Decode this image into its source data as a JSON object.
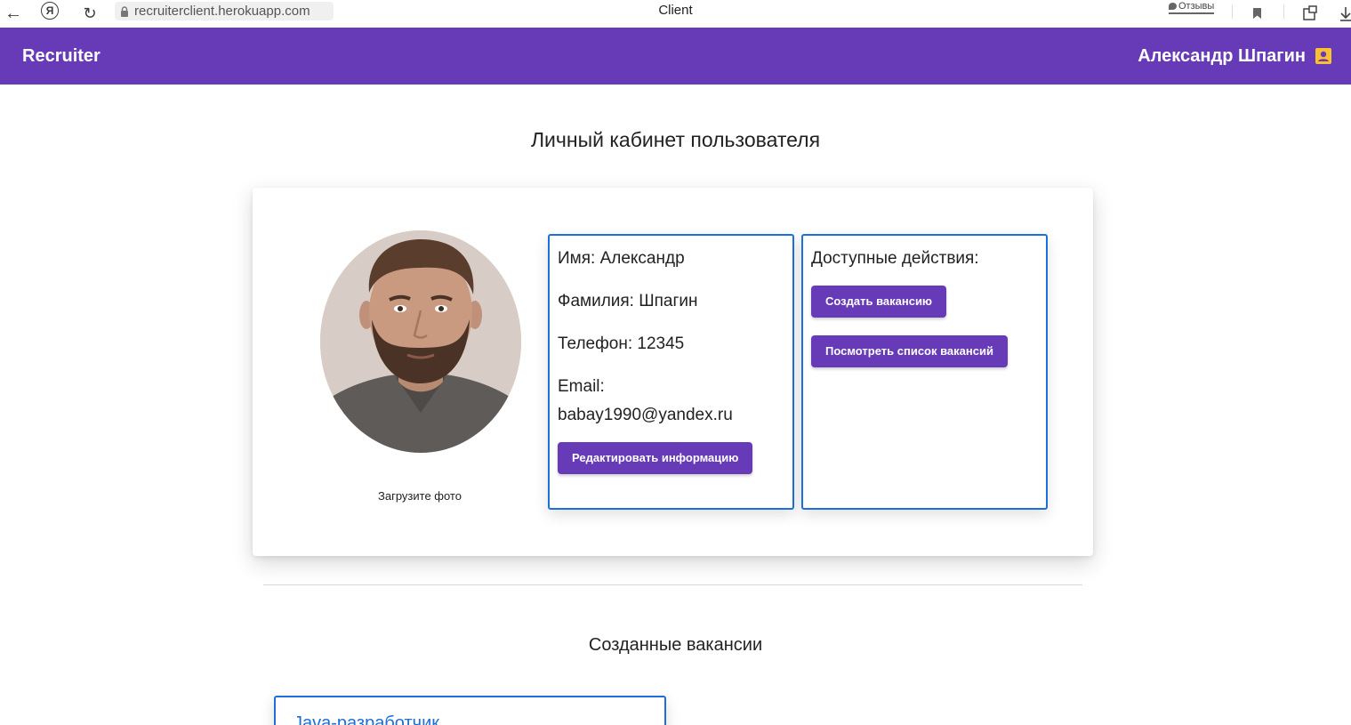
{
  "browser": {
    "url": "recruiterclient.herokuapp.com",
    "tab_title": "Client",
    "feedback_label": "Отзывы",
    "yandex_glyph": "Я"
  },
  "header": {
    "brand": "Recruiter",
    "user_name": "Александр Шпагин",
    "user_icon": "account-box-icon",
    "accent_color": "#673ab7",
    "user_icon_color": "#fbc02d"
  },
  "page": {
    "title": "Личный кабинет пользователя"
  },
  "profile": {
    "upload_label": "Загрузите фото",
    "first_name": "Имя: Александр",
    "last_name": "Фамилия: Шпагин",
    "phone": "Телефон: 12345",
    "email_label": "Email:",
    "email_value": "babay1990@yandex.ru",
    "edit_button": "Редактировать информацию"
  },
  "actions": {
    "title": "Доступные действия:",
    "create_button": "Создать вакансию",
    "list_button": "Посмотреть список вакансий"
  },
  "vacancies": {
    "section_title": "Созданные вакансии",
    "items": [
      {
        "title": "Java-разработчик"
      }
    ]
  }
}
